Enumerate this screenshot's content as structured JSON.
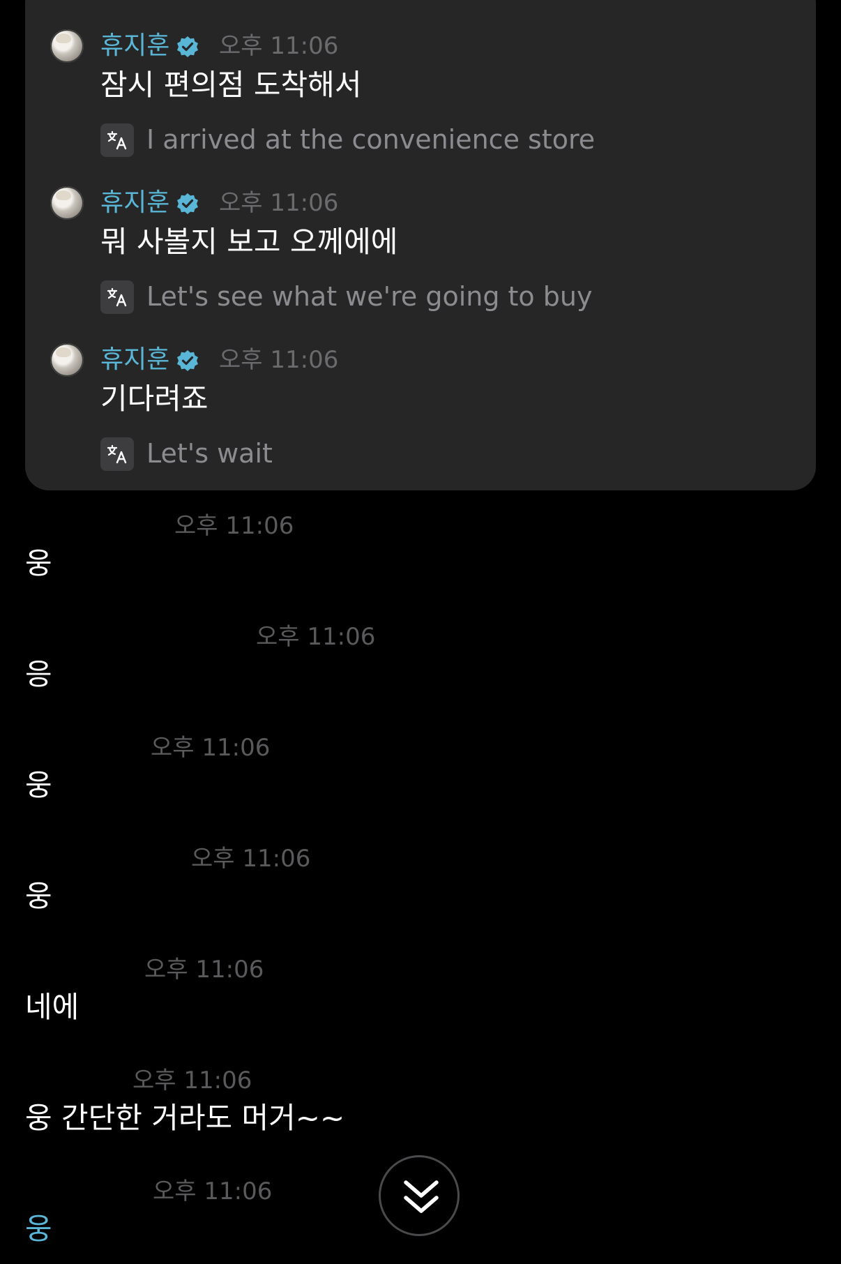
{
  "artist_messages": [
    {
      "sender": "휴지훈",
      "time": "오후 11:06",
      "text": "잠시 편의점 도착해서",
      "translation": "I arrived at the convenience store"
    },
    {
      "sender": "휴지훈",
      "time": "오후 11:06",
      "text": "뭐 사볼지 보고 오께에에",
      "translation": "Let's see what we're going to buy"
    },
    {
      "sender": "휴지훈",
      "time": "오후 11:06",
      "text": "기다려죠",
      "translation": "Let's wait"
    }
  ],
  "fan_messages": [
    {
      "time": "오후 11:06",
      "text": "웅"
    },
    {
      "time": "오후 11:06",
      "text": "응"
    },
    {
      "time": "오후 11:06",
      "text": "웅"
    },
    {
      "time": "오후 11:06",
      "text": "웅"
    },
    {
      "time": "오후 11:06",
      "text": "네에"
    },
    {
      "time": "오후 11:06",
      "text": "웅 간단한 거라도 머거~~"
    },
    {
      "time": "오후 11:06",
      "text": "웅"
    }
  ],
  "colors": {
    "accent": "#5ab6d6",
    "panel": "#262627",
    "background": "#000000"
  },
  "icons": {
    "verified": "verified-badge-icon",
    "translate": "translate-icon",
    "scroll_down": "double-chevron-down-icon"
  }
}
